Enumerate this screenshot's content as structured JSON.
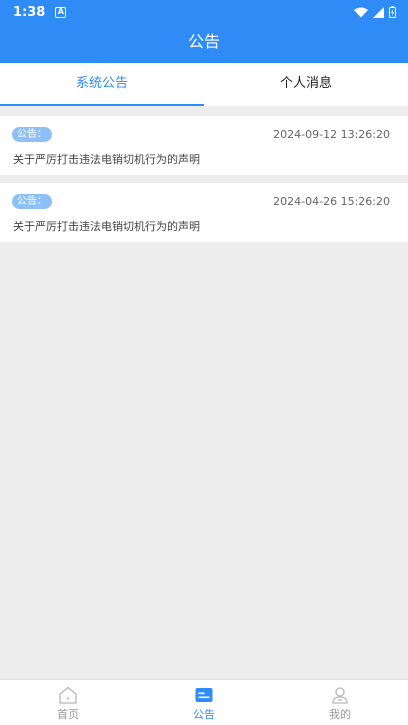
{
  "status_bar": {
    "time": "1:38",
    "app_icon_letter": "A"
  },
  "app_bar": {
    "title": "公告"
  },
  "tabs": [
    {
      "label": "系统公告",
      "active": true
    },
    {
      "label": "个人消息",
      "active": false
    }
  ],
  "notices": [
    {
      "badge": "公告：",
      "date": "2024-09-12 13:26:20",
      "title": "关于严厉打击违法电销切机行为的声明"
    },
    {
      "badge": "公告：",
      "date": "2024-04-26 15:26:20",
      "title": "关于严厉打击违法电销切机行为的声明"
    }
  ],
  "bottom_nav": [
    {
      "label": "首页",
      "icon": "home-icon",
      "active": false
    },
    {
      "label": "公告",
      "icon": "notice-icon",
      "active": true
    },
    {
      "label": "我的",
      "icon": "profile-icon",
      "active": false
    }
  ],
  "colors": {
    "primary": "#2f8cf7",
    "badge": "#8ec0f7",
    "background": "#ededed"
  }
}
